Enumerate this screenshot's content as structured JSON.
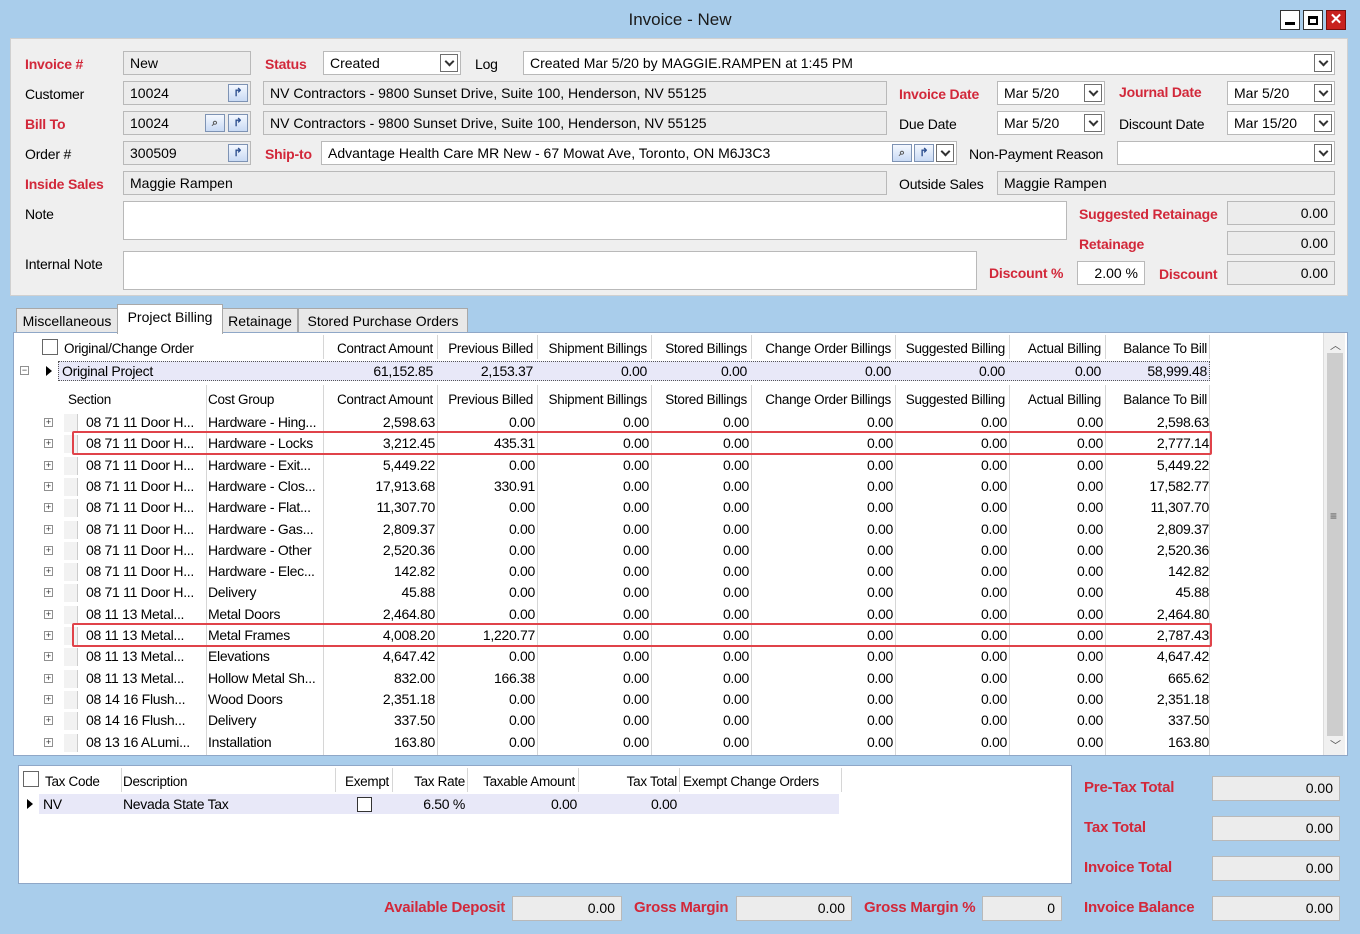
{
  "window": {
    "title": "Invoice - New"
  },
  "header": {
    "invoice_no": {
      "label": "Invoice #",
      "value": "New"
    },
    "status": {
      "label": "Status",
      "value": "Created"
    },
    "log": {
      "label": "Log",
      "value": "Created Mar 5/20 by MAGGIE.RAMPEN at 1:45 PM"
    },
    "customer": {
      "label": "Customer",
      "value": "10024",
      "address": "NV Contractors - 9800 Sunset Drive, Suite 100, Henderson, NV  55125"
    },
    "bill_to": {
      "label": "Bill To",
      "value": "10024",
      "address": "NV Contractors - 9800 Sunset Drive, Suite 100, Henderson, NV  55125"
    },
    "order": {
      "label": "Order #",
      "value": "300509"
    },
    "ship_to": {
      "label": "Ship-to",
      "value": "Advantage Health Care MR New - 67 Mowat Ave, Toronto, ON  M6J3C3"
    },
    "inside_sales": {
      "label": "Inside Sales",
      "value": "Maggie Rampen"
    },
    "outside_sales": {
      "label": "Outside Sales",
      "value": "Maggie Rampen"
    },
    "invoice_date": {
      "label": "Invoice Date",
      "value": "Mar 5/20"
    },
    "journal_date": {
      "label": "Journal Date",
      "value": "Mar 5/20"
    },
    "due_date": {
      "label": "Due Date",
      "value": "Mar 5/20"
    },
    "discount_date": {
      "label": "Discount Date",
      "value": "Mar 15/20"
    },
    "non_payment_reason": {
      "label": "Non-Payment Reason",
      "value": ""
    },
    "note": {
      "label": "Note",
      "value": ""
    },
    "internal_note": {
      "label": "Internal Note",
      "value": ""
    },
    "suggested_retainage": {
      "label": "Suggested Retainage",
      "value": "0.00"
    },
    "retainage": {
      "label": "Retainage",
      "value": "0.00"
    },
    "discount_pct": {
      "label": "Discount %",
      "value": "2.00 %"
    },
    "discount": {
      "label": "Discount",
      "value": "0.00"
    }
  },
  "tabs": [
    "Miscellaneous",
    "Project Billing",
    "Retainage",
    "Stored Purchase Orders"
  ],
  "billing_grid": {
    "top_columns": [
      "Original/Change Order",
      "Contract Amount",
      "Previous Billed",
      "Shipment Billings",
      "Stored Billings",
      "Change Order Billings",
      "Suggested Billing",
      "Actual Billing",
      "Balance To Bill"
    ],
    "original_row": [
      "Original Project",
      "61,152.85",
      "2,153.37",
      "0.00",
      "0.00",
      "0.00",
      "0.00",
      "0.00",
      "58,999.48"
    ],
    "sub_columns": [
      "Section",
      "Cost Group",
      "Contract Amount",
      "Previous Billed",
      "Shipment Billings",
      "Stored Billings",
      "Change Order Billings",
      "Suggested Billing",
      "Actual Billing",
      "Balance To Bill"
    ],
    "rows": [
      [
        "08 71 11 Door H...",
        "Hardware - Hing...",
        "2,598.63",
        "0.00",
        "0.00",
        "0.00",
        "0.00",
        "0.00",
        "0.00",
        "2,598.63"
      ],
      [
        "08 71 11 Door H...",
        "Hardware - Locks",
        "3,212.45",
        "435.31",
        "0.00",
        "0.00",
        "0.00",
        "0.00",
        "0.00",
        "2,777.14"
      ],
      [
        "08 71 11 Door H...",
        "Hardware - Exit...",
        "5,449.22",
        "0.00",
        "0.00",
        "0.00",
        "0.00",
        "0.00",
        "0.00",
        "5,449.22"
      ],
      [
        "08 71 11 Door H...",
        "Hardware - Clos...",
        "17,913.68",
        "330.91",
        "0.00",
        "0.00",
        "0.00",
        "0.00",
        "0.00",
        "17,582.77"
      ],
      [
        "08 71 11 Door H...",
        "Hardware - Flat...",
        "11,307.70",
        "0.00",
        "0.00",
        "0.00",
        "0.00",
        "0.00",
        "0.00",
        "11,307.70"
      ],
      [
        "08 71 11 Door H...",
        "Hardware - Gas...",
        "2,809.37",
        "0.00",
        "0.00",
        "0.00",
        "0.00",
        "0.00",
        "0.00",
        "2,809.37"
      ],
      [
        "08 71 11 Door H...",
        "Hardware - Other",
        "2,520.36",
        "0.00",
        "0.00",
        "0.00",
        "0.00",
        "0.00",
        "0.00",
        "2,520.36"
      ],
      [
        "08 71 11 Door H...",
        "Hardware - Elec...",
        "142.82",
        "0.00",
        "0.00",
        "0.00",
        "0.00",
        "0.00",
        "0.00",
        "142.82"
      ],
      [
        "08 71 11 Door H...",
        "Delivery",
        "45.88",
        "0.00",
        "0.00",
        "0.00",
        "0.00",
        "0.00",
        "0.00",
        "45.88"
      ],
      [
        "08 11 13 Metal...",
        "Metal Doors",
        "2,464.80",
        "0.00",
        "0.00",
        "0.00",
        "0.00",
        "0.00",
        "0.00",
        "2,464.80"
      ],
      [
        "08 11 13 Metal...",
        "Metal Frames",
        "4,008.20",
        "1,220.77",
        "0.00",
        "0.00",
        "0.00",
        "0.00",
        "0.00",
        "2,787.43"
      ],
      [
        "08 11 13 Metal...",
        "Elevations",
        "4,647.42",
        "0.00",
        "0.00",
        "0.00",
        "0.00",
        "0.00",
        "0.00",
        "4,647.42"
      ],
      [
        "08 11 13 Metal...",
        "Hollow Metal Sh...",
        "832.00",
        "166.38",
        "0.00",
        "0.00",
        "0.00",
        "0.00",
        "0.00",
        "665.62"
      ],
      [
        "08 14 16 Flush...",
        "Wood Doors",
        "2,351.18",
        "0.00",
        "0.00",
        "0.00",
        "0.00",
        "0.00",
        "0.00",
        "2,351.18"
      ],
      [
        "08 14 16 Flush...",
        "Delivery",
        "337.50",
        "0.00",
        "0.00",
        "0.00",
        "0.00",
        "0.00",
        "0.00",
        "337.50"
      ],
      [
        "08 13 16 ALumi...",
        "Installation",
        "163.80",
        "0.00",
        "0.00",
        "0.00",
        "0.00",
        "0.00",
        "0.00",
        "163.80"
      ]
    ]
  },
  "tax_grid": {
    "columns": [
      "Tax Code",
      "Description",
      "Exempt",
      "Tax Rate",
      "Taxable Amount",
      "Tax Total",
      "Exempt Change Orders"
    ],
    "rows": [
      [
        "NV",
        "Nevada State Tax",
        "",
        "6.50 %",
        "0.00",
        "0.00",
        ""
      ]
    ]
  },
  "totals": {
    "pre_tax_total": {
      "label": "Pre-Tax Total",
      "value": "0.00"
    },
    "tax_total": {
      "label": "Tax Total",
      "value": "0.00"
    },
    "invoice_total": {
      "label": "Invoice Total",
      "value": "0.00"
    },
    "invoice_balance": {
      "label": "Invoice Balance",
      "value": "0.00"
    },
    "available_deposit": {
      "label": "Available Deposit",
      "value": "0.00"
    },
    "gross_margin": {
      "label": "Gross Margin",
      "value": "0.00"
    },
    "gross_margin_pct": {
      "label": "Gross Margin %",
      "value": "0"
    }
  },
  "colors": {
    "label_red": "#d2283a",
    "highlight": "#e0434a",
    "frame": "#a9cdeb"
  },
  "icons": [
    "minimize-icon",
    "maximize-icon",
    "close-icon",
    "dropdown-chevron-icon",
    "lookup-icon",
    "magnifier-icon",
    "expand-plus-icon",
    "collapse-minus-icon",
    "row-pointer-icon",
    "scroll-up-icon",
    "scroll-down-icon",
    "scroll-grip-icon"
  ]
}
